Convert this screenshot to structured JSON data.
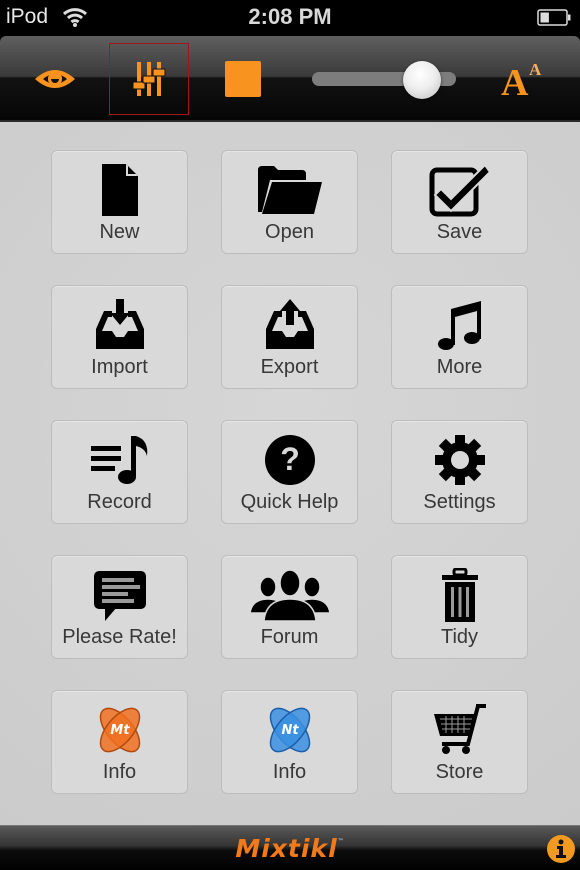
{
  "status_bar": {
    "carrier": "iPod",
    "time": "2:08 PM",
    "battery_level": 0.35,
    "wifi_icon": "wifi-icon",
    "battery_icon": "battery-icon"
  },
  "toolbar": {
    "items": [
      {
        "name": "eye",
        "icon": "eye-icon"
      },
      {
        "name": "mixer",
        "icon": "sliders-icon",
        "selected": true
      },
      {
        "name": "stop",
        "icon": "stop-icon"
      },
      {
        "name": "font-size",
        "icon": "font-size-icon"
      }
    ],
    "slider_value": 0.82,
    "accent_color": "#f7931e",
    "selection_color": "#a11616"
  },
  "grid": {
    "tiles": [
      {
        "label": "New",
        "icon": "new-document-icon"
      },
      {
        "label": "Open",
        "icon": "open-folder-icon"
      },
      {
        "label": "Save",
        "icon": "checkbox-save-icon"
      },
      {
        "label": "Import",
        "icon": "import-tray-icon"
      },
      {
        "label": "Export",
        "icon": "export-tray-icon"
      },
      {
        "label": "More",
        "icon": "music-note-icon"
      },
      {
        "label": "Record",
        "icon": "playlist-note-icon"
      },
      {
        "label": "Quick Help",
        "icon": "question-circle-icon"
      },
      {
        "label": "Settings",
        "icon": "gear-icon"
      },
      {
        "label": "Please Rate!",
        "icon": "speech-bubble-icon"
      },
      {
        "label": "Forum",
        "icon": "group-users-icon"
      },
      {
        "label": "Tidy",
        "icon": "trash-icon"
      },
      {
        "label": "Info",
        "icon": "mixtikl-logo-icon",
        "logo_text": "Mt",
        "logo_color": "#f07020"
      },
      {
        "label": "Info",
        "icon": "noatikl-logo-icon",
        "logo_text": "Nt",
        "logo_color": "#3a8fe0"
      },
      {
        "label": "Store",
        "icon": "shopping-cart-icon"
      }
    ]
  },
  "footer": {
    "brand": "Mixtikl",
    "trademark": "™",
    "brand_color": "#f37a18",
    "info_icon": "info-icon"
  }
}
